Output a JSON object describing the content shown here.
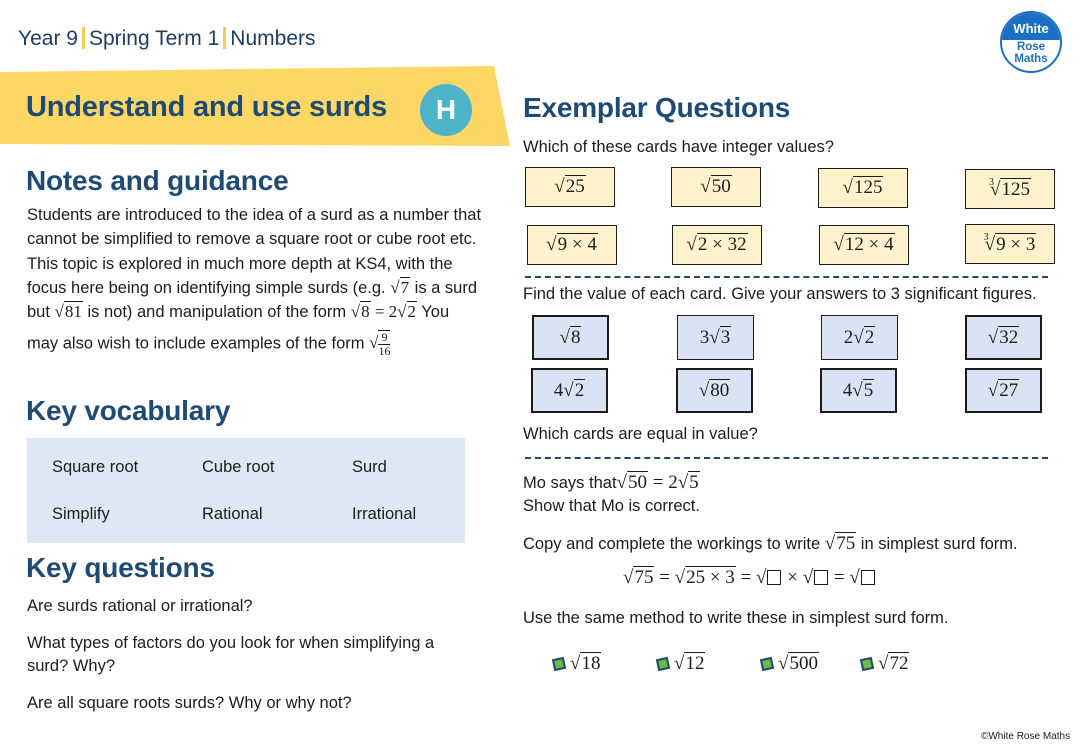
{
  "header": {
    "breadcrumb": [
      "Year 9",
      "Spring Term 1",
      "Numbers"
    ],
    "logo": {
      "line1": "White",
      "line2": "Rose",
      "line3": "Maths"
    },
    "title": "Understand and use surds",
    "tier_badge": "H",
    "colors": {
      "banner": "#fcd766",
      "badge": "#4cb3c8",
      "heading": "#1f4a73",
      "logo": "#1b6fc4"
    }
  },
  "notes": {
    "heading": "Notes and guidance",
    "lines": [
      "Students are introduced to the idea of a surd as a number that",
      "cannot be simplified to remove a square root or cube root etc.",
      "This topic is explored in much more depth at KS4, with the",
      "focus here being on identifying simple surds (e.g.",
      "is a surd",
      "but",
      "is not) and manipulation of the form",
      "You",
      "may also wish to include examples of the form"
    ],
    "math": {
      "example_surd": "7",
      "example_nonsurd": "81",
      "form_lhs": "8",
      "form_eq": " = 2",
      "form_rhs": "2",
      "frac_num": "9",
      "frac_den": "16"
    }
  },
  "vocabulary": {
    "heading": "Key vocabulary",
    "items": [
      "Square root",
      "Cube root",
      "Surd",
      "Simplify",
      "Rational",
      "Irrational"
    ]
  },
  "key_questions": {
    "heading": "Key questions",
    "items": [
      "Are surds rational or irrational?",
      "What types of factors do you look for when simplifying a surd?  Why?",
      "Are all square roots surds? Why or why not?"
    ]
  },
  "exemplar": {
    "heading": "Exemplar Questions",
    "q1": {
      "prompt": "Which of these cards have integer values?",
      "cards": [
        {
          "index": "",
          "radicand": "25"
        },
        {
          "index": "",
          "radicand": "50"
        },
        {
          "index": "",
          "radicand": "125"
        },
        {
          "index": "3",
          "radicand": "125"
        },
        {
          "index": "",
          "radicand": "9 × 4"
        },
        {
          "index": "",
          "radicand": "2 × 32"
        },
        {
          "index": "",
          "radicand": "12 × 4"
        },
        {
          "index": "3",
          "radicand": "9 × 3"
        }
      ]
    },
    "q2": {
      "prompt": "Find the value of each card. Give your answers to 3 significant figures.",
      "cards": [
        {
          "coef": "",
          "radicand": "8"
        },
        {
          "coef": "3",
          "radicand": "3"
        },
        {
          "coef": "2",
          "radicand": "2"
        },
        {
          "coef": "",
          "radicand": "32"
        },
        {
          "coef": "4",
          "radicand": "2"
        },
        {
          "coef": "",
          "radicand": "80"
        },
        {
          "coef": "4",
          "radicand": "5"
        },
        {
          "coef": "",
          "radicand": "27"
        }
      ],
      "follow_up": "Which cards are equal in value?"
    },
    "q3": {
      "prefix": "Mo says that",
      "lhs": "50",
      "eq": " = 2",
      "rhs": "5",
      "line2": "Show that Mo is correct."
    },
    "q4": {
      "prompt_before": "Copy and complete the workings to write",
      "prompt_radicand": "75",
      "prompt_after": "in simplest surd form.",
      "working": {
        "r1": "75",
        "eq1": " = ",
        "r2": "25 × 3",
        "eq2": " = ",
        "times": " × ",
        "eq3": " = "
      },
      "instruction": "Use the same method to write these in simplest surd form.",
      "practice": [
        "18",
        "12",
        "500",
        "72"
      ]
    }
  },
  "footer": {
    "copyright": "©White Rose Maths"
  }
}
